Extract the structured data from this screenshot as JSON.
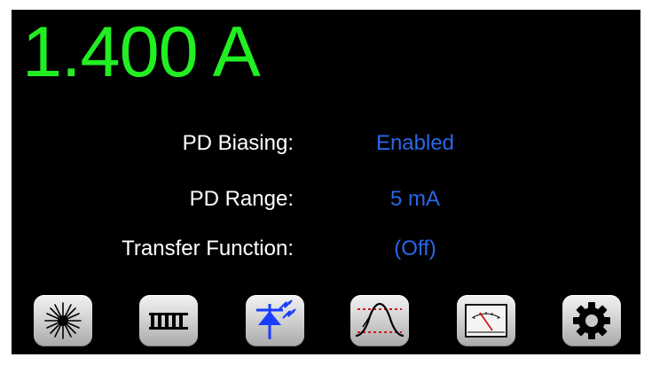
{
  "readout": {
    "value": "1.400 A"
  },
  "rows": [
    {
      "label": "PD Biasing:",
      "value": "Enabled"
    },
    {
      "label": "PD Range:",
      "value": "5 mA"
    },
    {
      "label": "Transfer Function:",
      "value": "(Off)"
    }
  ],
  "toolbar": {
    "buttons": [
      {
        "icon": "laser-icon"
      },
      {
        "icon": "tec-icon"
      },
      {
        "icon": "photodiode-icon"
      },
      {
        "icon": "modulation-icon"
      },
      {
        "icon": "meter-icon"
      },
      {
        "icon": "gear-icon"
      }
    ]
  },
  "colors": {
    "readout": "#22ee22",
    "label": "#ffffff",
    "value": "#2a66e8",
    "background": "#000000"
  }
}
